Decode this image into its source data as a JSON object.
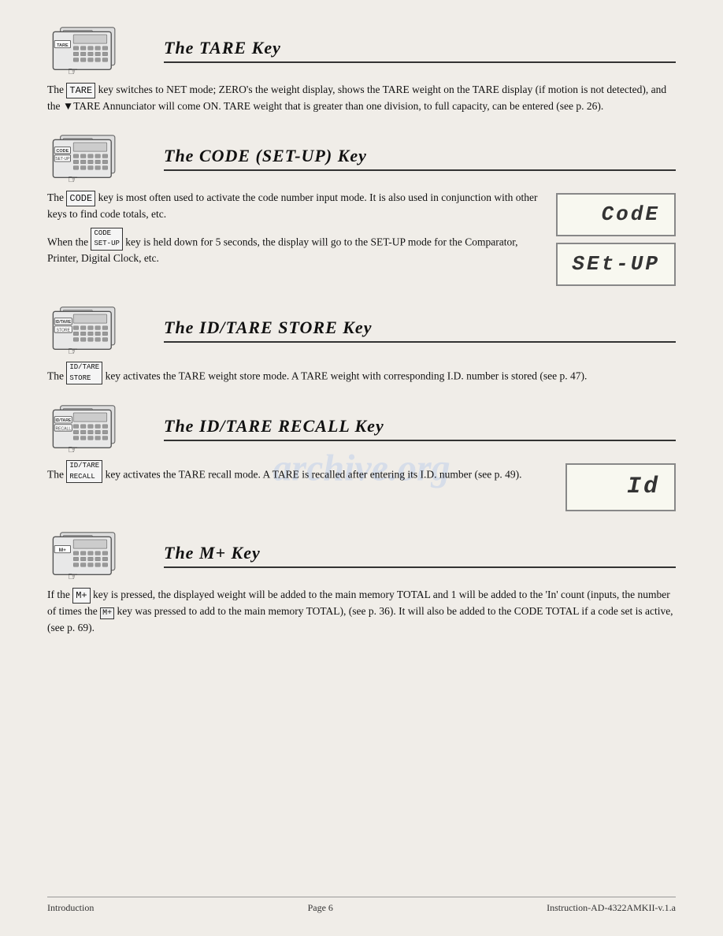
{
  "page": {
    "watermark": "archive.org",
    "footer": {
      "left": "Introduction",
      "center": "Page 6",
      "right": "Instruction-AD-4322AMKII-v.1.a"
    }
  },
  "sections": [
    {
      "id": "tare",
      "title": "The  TARE  Key",
      "key_label": "TARE",
      "body_paragraphs": [
        "The TARE key switches to NET mode; ZERO's the weight display, shows the TARE weight on the TARE display (if motion is not detected), and the ▼TARE Annunciator will come ON.  TARE weight that is greater than one division, to full capacity, can be entered (see p. 26)."
      ],
      "has_display": false
    },
    {
      "id": "code",
      "title": "The  CODE  (SET-UP)  Key",
      "key_label": "CODE",
      "key_label2": "SET-UP",
      "body_paragraphs": [
        "The CODE key is most often used to activate the code number input mode.  It is also used in conjunction with other keys to find code totals, etc.",
        "When the CODE key is held down for 5 seconds, the display will go to the SET-UP mode for the Comparator, Printer, Digital Clock, etc."
      ],
      "displays": [
        "CodE",
        "SEt-UP"
      ],
      "has_display": true
    },
    {
      "id": "idtare-store",
      "title": "The  ID/TARE  STORE  Key",
      "key_label": "ID/TARE",
      "key_label2": "STORE",
      "body_paragraphs": [
        "The ID/TARE STORE key activates the TARE weight store mode.  A TARE weight with corresponding I.D. number is stored (see p. 47)."
      ],
      "has_display": false
    },
    {
      "id": "idtare-recall",
      "title": "The  ID/TARE  RECALL  Key",
      "key_label": "ID/TARE",
      "key_label2": "RECALL",
      "body_paragraphs": [
        "The ID/TARE RECALL key activates the TARE recall mode.  A TARE is recalled after entering its I.D. number (see p. 49)."
      ],
      "displays": [
        "Id"
      ],
      "has_display": true
    },
    {
      "id": "mplus",
      "title": "The  M+  Key",
      "key_label": "M+",
      "body_paragraphs": [
        "If the M+ key is pressed, the displayed weight will be added to the main memory TOTAL and 1 will be added to the 'In' count (inputs, the number of times the M+ key was pressed to add to the main memory TOTAL), (see p. 36).  It will also be added to the CODE TOTAL if a code set is active, (see p. 69)."
      ],
      "has_display": false
    }
  ]
}
